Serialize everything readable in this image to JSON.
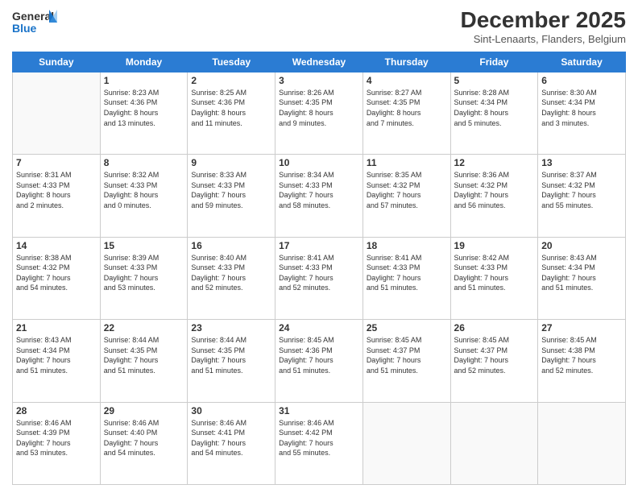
{
  "logo": {
    "line1": "General",
    "line2": "Blue"
  },
  "header": {
    "title": "December 2025",
    "subtitle": "Sint-Lenaarts, Flanders, Belgium"
  },
  "days_of_week": [
    "Sunday",
    "Monday",
    "Tuesday",
    "Wednesday",
    "Thursday",
    "Friday",
    "Saturday"
  ],
  "weeks": [
    [
      {
        "day": "",
        "info": ""
      },
      {
        "day": "1",
        "info": "Sunrise: 8:23 AM\nSunset: 4:36 PM\nDaylight: 8 hours\nand 13 minutes."
      },
      {
        "day": "2",
        "info": "Sunrise: 8:25 AM\nSunset: 4:36 PM\nDaylight: 8 hours\nand 11 minutes."
      },
      {
        "day": "3",
        "info": "Sunrise: 8:26 AM\nSunset: 4:35 PM\nDaylight: 8 hours\nand 9 minutes."
      },
      {
        "day": "4",
        "info": "Sunrise: 8:27 AM\nSunset: 4:35 PM\nDaylight: 8 hours\nand 7 minutes."
      },
      {
        "day": "5",
        "info": "Sunrise: 8:28 AM\nSunset: 4:34 PM\nDaylight: 8 hours\nand 5 minutes."
      },
      {
        "day": "6",
        "info": "Sunrise: 8:30 AM\nSunset: 4:34 PM\nDaylight: 8 hours\nand 3 minutes."
      }
    ],
    [
      {
        "day": "7",
        "info": "Sunrise: 8:31 AM\nSunset: 4:33 PM\nDaylight: 8 hours\nand 2 minutes."
      },
      {
        "day": "8",
        "info": "Sunrise: 8:32 AM\nSunset: 4:33 PM\nDaylight: 8 hours\nand 0 minutes."
      },
      {
        "day": "9",
        "info": "Sunrise: 8:33 AM\nSunset: 4:33 PM\nDaylight: 7 hours\nand 59 minutes."
      },
      {
        "day": "10",
        "info": "Sunrise: 8:34 AM\nSunset: 4:33 PM\nDaylight: 7 hours\nand 58 minutes."
      },
      {
        "day": "11",
        "info": "Sunrise: 8:35 AM\nSunset: 4:32 PM\nDaylight: 7 hours\nand 57 minutes."
      },
      {
        "day": "12",
        "info": "Sunrise: 8:36 AM\nSunset: 4:32 PM\nDaylight: 7 hours\nand 56 minutes."
      },
      {
        "day": "13",
        "info": "Sunrise: 8:37 AM\nSunset: 4:32 PM\nDaylight: 7 hours\nand 55 minutes."
      }
    ],
    [
      {
        "day": "14",
        "info": "Sunrise: 8:38 AM\nSunset: 4:32 PM\nDaylight: 7 hours\nand 54 minutes."
      },
      {
        "day": "15",
        "info": "Sunrise: 8:39 AM\nSunset: 4:33 PM\nDaylight: 7 hours\nand 53 minutes."
      },
      {
        "day": "16",
        "info": "Sunrise: 8:40 AM\nSunset: 4:33 PM\nDaylight: 7 hours\nand 52 minutes."
      },
      {
        "day": "17",
        "info": "Sunrise: 8:41 AM\nSunset: 4:33 PM\nDaylight: 7 hours\nand 52 minutes."
      },
      {
        "day": "18",
        "info": "Sunrise: 8:41 AM\nSunset: 4:33 PM\nDaylight: 7 hours\nand 51 minutes."
      },
      {
        "day": "19",
        "info": "Sunrise: 8:42 AM\nSunset: 4:33 PM\nDaylight: 7 hours\nand 51 minutes."
      },
      {
        "day": "20",
        "info": "Sunrise: 8:43 AM\nSunset: 4:34 PM\nDaylight: 7 hours\nand 51 minutes."
      }
    ],
    [
      {
        "day": "21",
        "info": "Sunrise: 8:43 AM\nSunset: 4:34 PM\nDaylight: 7 hours\nand 51 minutes."
      },
      {
        "day": "22",
        "info": "Sunrise: 8:44 AM\nSunset: 4:35 PM\nDaylight: 7 hours\nand 51 minutes."
      },
      {
        "day": "23",
        "info": "Sunrise: 8:44 AM\nSunset: 4:35 PM\nDaylight: 7 hours\nand 51 minutes."
      },
      {
        "day": "24",
        "info": "Sunrise: 8:45 AM\nSunset: 4:36 PM\nDaylight: 7 hours\nand 51 minutes."
      },
      {
        "day": "25",
        "info": "Sunrise: 8:45 AM\nSunset: 4:37 PM\nDaylight: 7 hours\nand 51 minutes."
      },
      {
        "day": "26",
        "info": "Sunrise: 8:45 AM\nSunset: 4:37 PM\nDaylight: 7 hours\nand 52 minutes."
      },
      {
        "day": "27",
        "info": "Sunrise: 8:45 AM\nSunset: 4:38 PM\nDaylight: 7 hours\nand 52 minutes."
      }
    ],
    [
      {
        "day": "28",
        "info": "Sunrise: 8:46 AM\nSunset: 4:39 PM\nDaylight: 7 hours\nand 53 minutes."
      },
      {
        "day": "29",
        "info": "Sunrise: 8:46 AM\nSunset: 4:40 PM\nDaylight: 7 hours\nand 54 minutes."
      },
      {
        "day": "30",
        "info": "Sunrise: 8:46 AM\nSunset: 4:41 PM\nDaylight: 7 hours\nand 54 minutes."
      },
      {
        "day": "31",
        "info": "Sunrise: 8:46 AM\nSunset: 4:42 PM\nDaylight: 7 hours\nand 55 minutes."
      },
      {
        "day": "",
        "info": ""
      },
      {
        "day": "",
        "info": ""
      },
      {
        "day": "",
        "info": ""
      }
    ]
  ]
}
